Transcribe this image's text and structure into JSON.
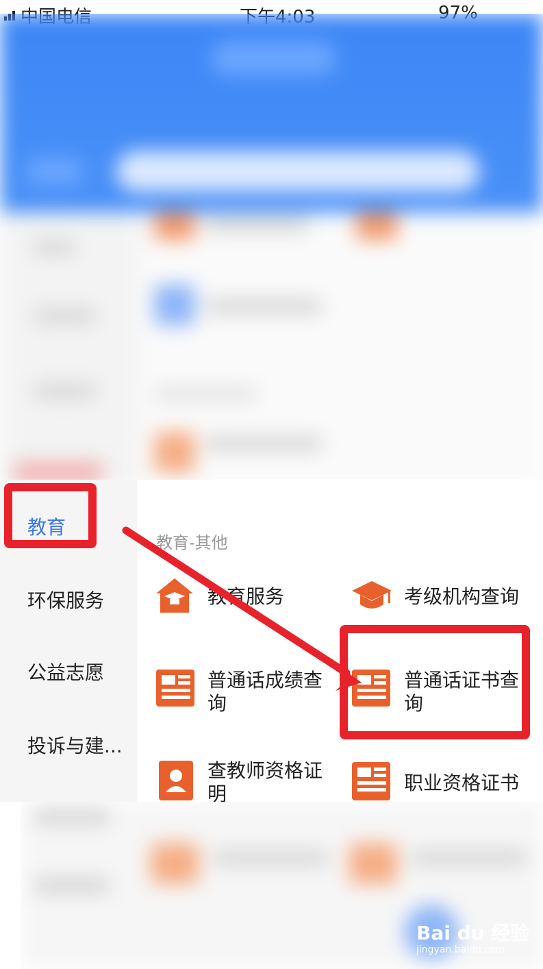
{
  "status_bar": {
    "carrier": "中国电信",
    "time": "下午4:03",
    "battery": "97%"
  },
  "sidebar": {
    "items": [
      {
        "label": "教育",
        "active": true
      },
      {
        "label": "环保服务"
      },
      {
        "label": "公益志愿"
      },
      {
        "label": "投诉与建..."
      }
    ]
  },
  "section_title": "教育-其他",
  "services": [
    {
      "label_l1": "教育服务",
      "label_l2": "",
      "icon": "school-icon"
    },
    {
      "label_l1": "考级机构查询",
      "label_l2": "",
      "icon": "graduation-cap-icon"
    },
    {
      "label_l1": "普通话成绩查",
      "label_l2": "询",
      "icon": "document-icon"
    },
    {
      "label_l1": "普通话证书查",
      "label_l2": "询",
      "icon": "document-icon"
    },
    {
      "label_l1": "查教师资格证",
      "label_l2": "明",
      "icon": "person-card-icon"
    },
    {
      "label_l1": "职业资格证书",
      "label_l2": "",
      "icon": "document-icon"
    }
  ],
  "watermark": {
    "brand": "Bai du 经验",
    "url": "jingyan.baidu.com"
  },
  "colors": {
    "accent": "#3a78e8",
    "icon": "#e8602c",
    "highlight": "#e8222b"
  }
}
